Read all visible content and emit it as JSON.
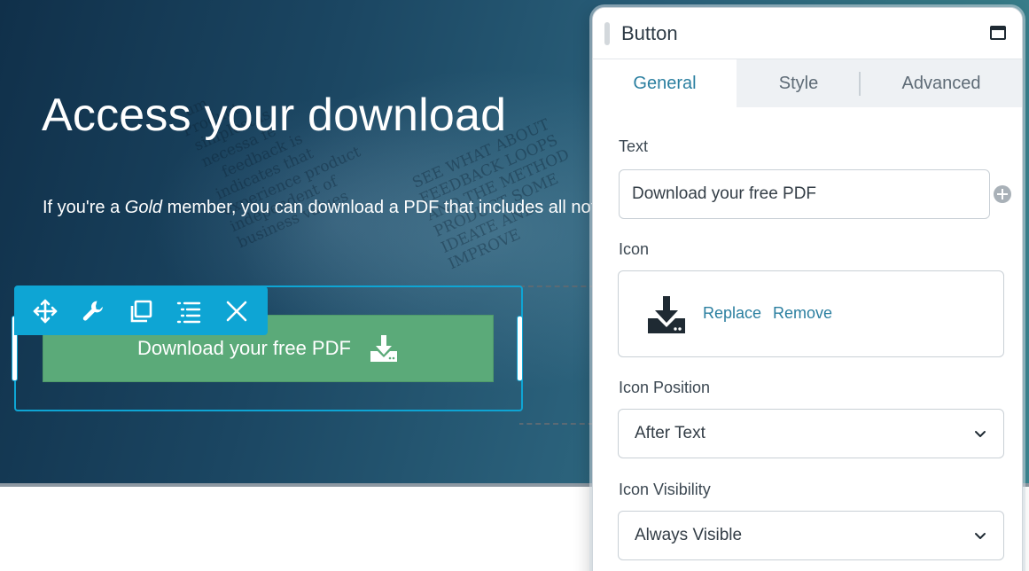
{
  "hero": {
    "title": "Access your download",
    "desc_prefix": "If you're a ",
    "desc_emph": "Gold",
    "desc_suffix": " member, you can download a PDF that includes all notes."
  },
  "toolbar": {
    "items": [
      {
        "icon": "move-icon"
      },
      {
        "icon": "wrench-icon"
      },
      {
        "icon": "duplicate-icon"
      },
      {
        "icon": "list-icon"
      },
      {
        "icon": "close-icon"
      }
    ]
  },
  "button": {
    "label": "Download your free PDF",
    "icon": "download-icon",
    "bg_color": "#5baa79"
  },
  "panel": {
    "title": "Button",
    "tabs": [
      {
        "label": "General",
        "active": true
      },
      {
        "label": "Style",
        "active": false
      },
      {
        "label": "Advanced",
        "active": false
      }
    ],
    "text_label": "Text",
    "text_value": "Download your free PDF",
    "icon_label": "Icon",
    "icon_replace": "Replace",
    "icon_remove": "Remove",
    "icon_position_label": "Icon Position",
    "icon_position_value": "After Text",
    "icon_visibility_label": "Icon Visibility",
    "icon_visibility_value": "Always Visible"
  },
  "colors": {
    "accent": "#0ea5d4",
    "link": "#2b7fa0"
  }
}
